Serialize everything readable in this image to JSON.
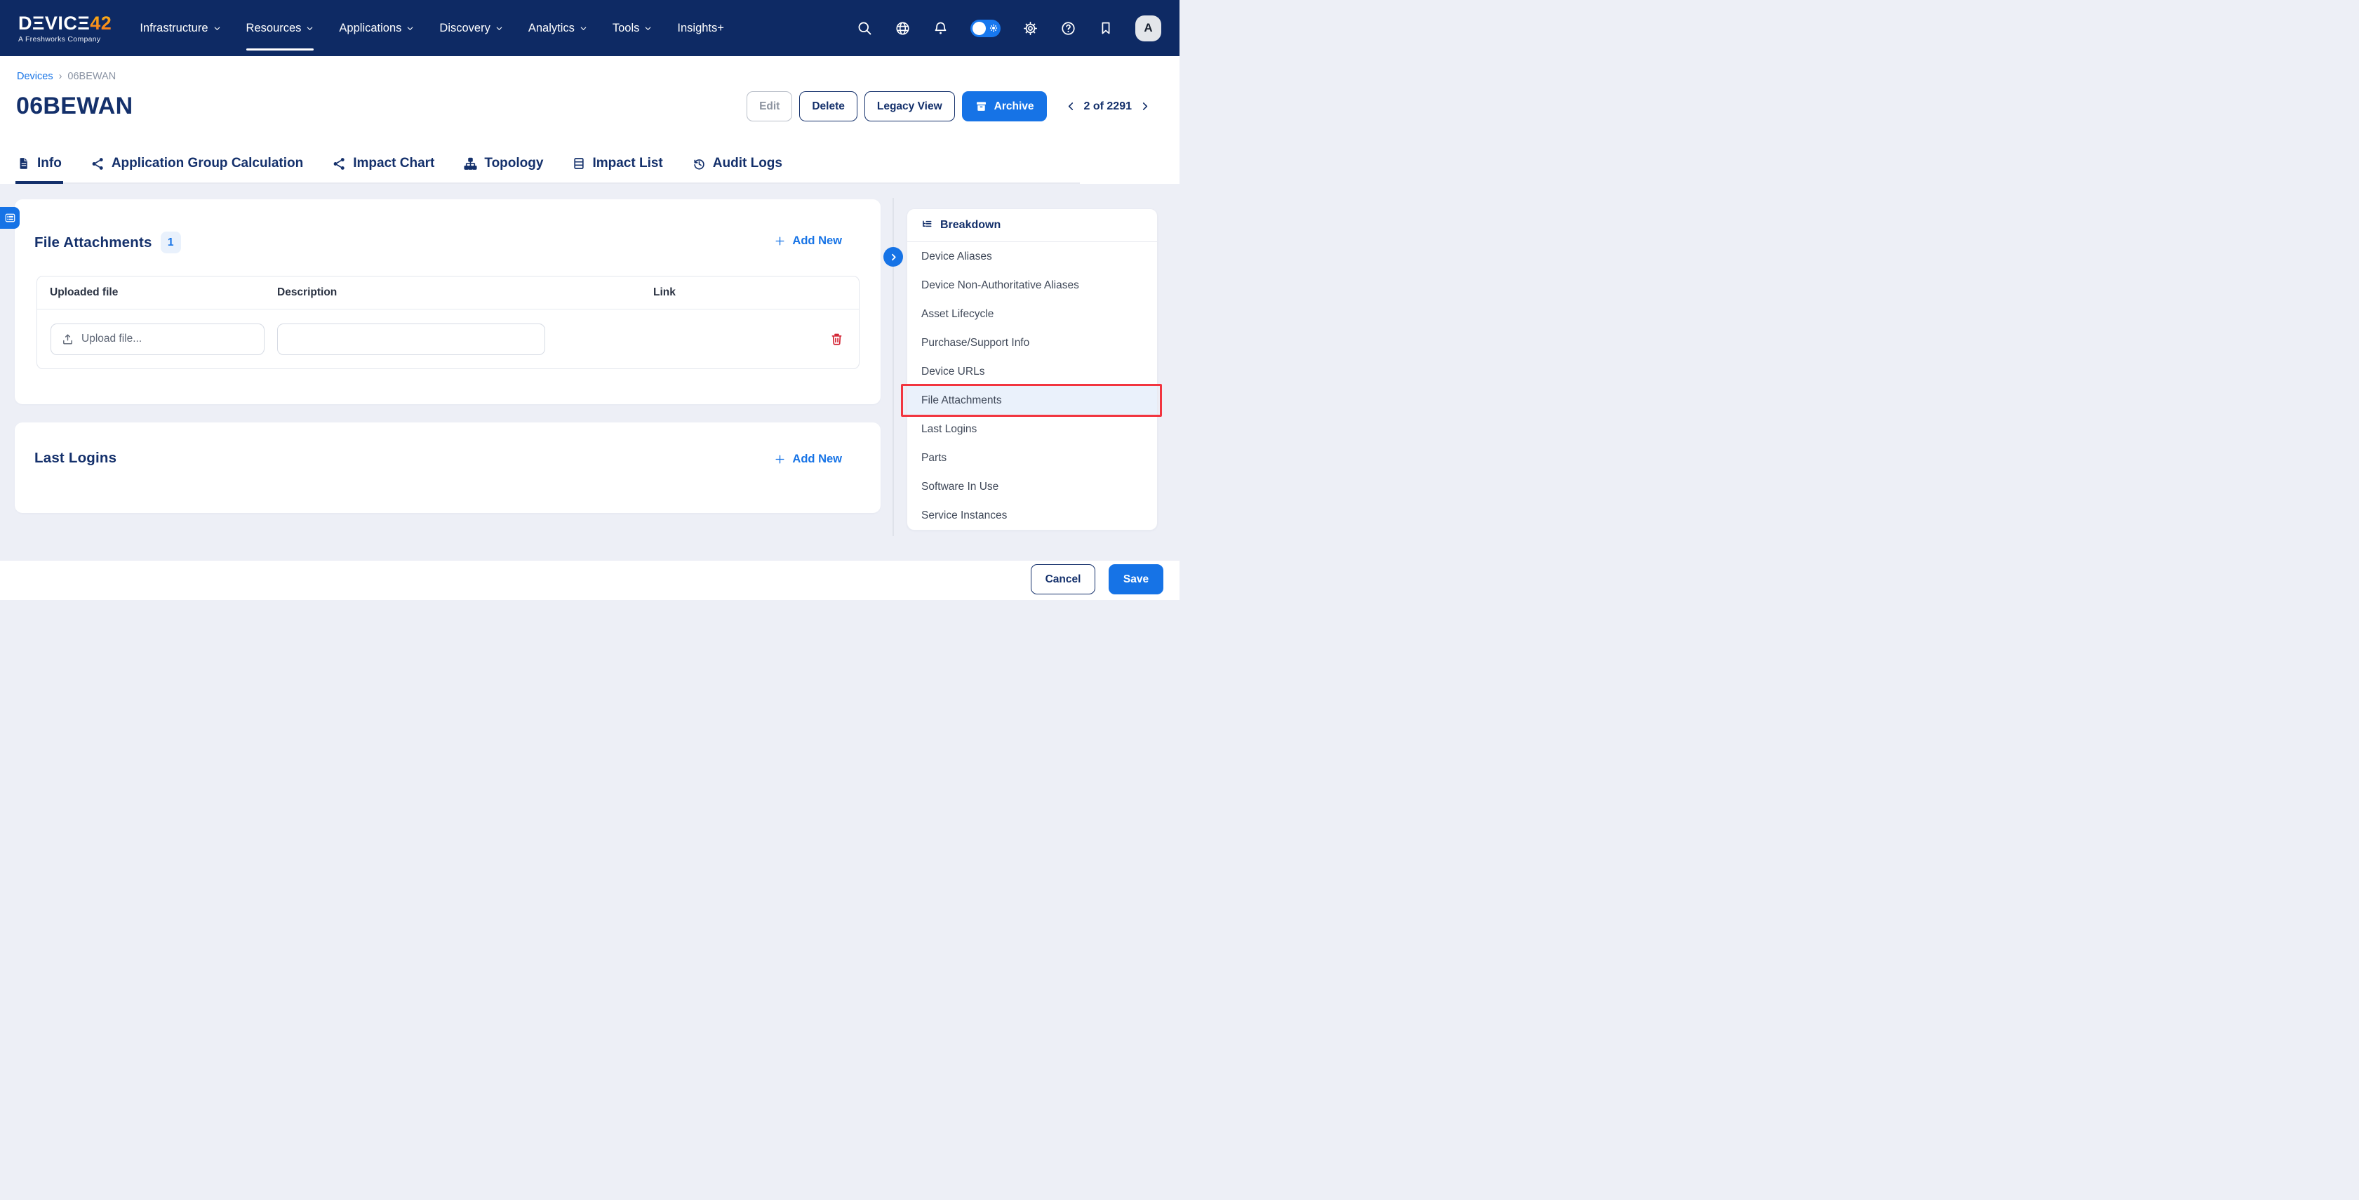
{
  "nav": {
    "logo": {
      "brand_main": "DΞVIC",
      "brand_e": "Ξ",
      "brand_num": "42",
      "tagline": "A Freshworks Company"
    },
    "menus": [
      {
        "label": "Infrastructure",
        "has_chevron": true,
        "active": false
      },
      {
        "label": "Resources",
        "has_chevron": true,
        "active": true
      },
      {
        "label": "Applications",
        "has_chevron": true,
        "active": false
      },
      {
        "label": "Discovery",
        "has_chevron": true,
        "active": false
      },
      {
        "label": "Analytics",
        "has_chevron": true,
        "active": false
      },
      {
        "label": "Tools",
        "has_chevron": true,
        "active": false
      },
      {
        "label": "Insights+",
        "has_chevron": false,
        "active": false
      }
    ],
    "icons": [
      "search-icon",
      "globe-icon",
      "bell-icon",
      "theme-toggle",
      "gear-icon",
      "help-icon",
      "bookmark-icon"
    ],
    "avatar_initial": "A"
  },
  "breadcrumb": {
    "parent": "Devices",
    "separator": "›",
    "current": "06BEWAN"
  },
  "page": {
    "title": "06BEWAN"
  },
  "actions": {
    "edit": "Edit",
    "delete": "Delete",
    "legacy_view": "Legacy View",
    "archive": "Archive",
    "pager_text": "2 of 2291"
  },
  "tabs": [
    {
      "label": "Info",
      "icon": "file-lines-icon",
      "active": true
    },
    {
      "label": "Application Group Calculation",
      "icon": "share-nodes-icon",
      "active": false
    },
    {
      "label": "Impact Chart",
      "icon": "share-nodes-icon",
      "active": false
    },
    {
      "label": "Topology",
      "icon": "sitemap-icon",
      "active": false
    },
    {
      "label": "Impact List",
      "icon": "table-icon",
      "active": false
    },
    {
      "label": "Audit Logs",
      "icon": "history-icon",
      "active": false
    }
  ],
  "file_attachments": {
    "title": "File Attachments",
    "count": "1",
    "add_new": "Add New",
    "columns": [
      "Uploaded file",
      "Description",
      "Link"
    ],
    "upload_label": "Upload file...",
    "description_value": ""
  },
  "last_logins": {
    "title": "Last Logins",
    "add_new": "Add New"
  },
  "sidebar": {
    "title": "Breakdown",
    "items": [
      {
        "label": "Device Aliases",
        "highlighted": false
      },
      {
        "label": "Device Non-Authoritative Aliases",
        "highlighted": false
      },
      {
        "label": "Asset Lifecycle",
        "highlighted": false
      },
      {
        "label": "Purchase/Support Info",
        "highlighted": false
      },
      {
        "label": "Device URLs",
        "highlighted": false
      },
      {
        "label": "File Attachments",
        "highlighted": true
      },
      {
        "label": "Last Logins",
        "highlighted": false
      },
      {
        "label": "Parts",
        "highlighted": false
      },
      {
        "label": "Software In Use",
        "highlighted": false
      },
      {
        "label": "Service Instances",
        "highlighted": false
      }
    ]
  },
  "footer": {
    "cancel": "Cancel",
    "save": "Save"
  },
  "colors": {
    "nav_navy": "#0e2a64",
    "navy_text": "#14306b",
    "accent_blue": "#1673e6",
    "page_bg": "#edeff6",
    "danger_red": "#d21f2f",
    "highlight_red": "#f2353f",
    "brand_orange": "#f7941d"
  }
}
